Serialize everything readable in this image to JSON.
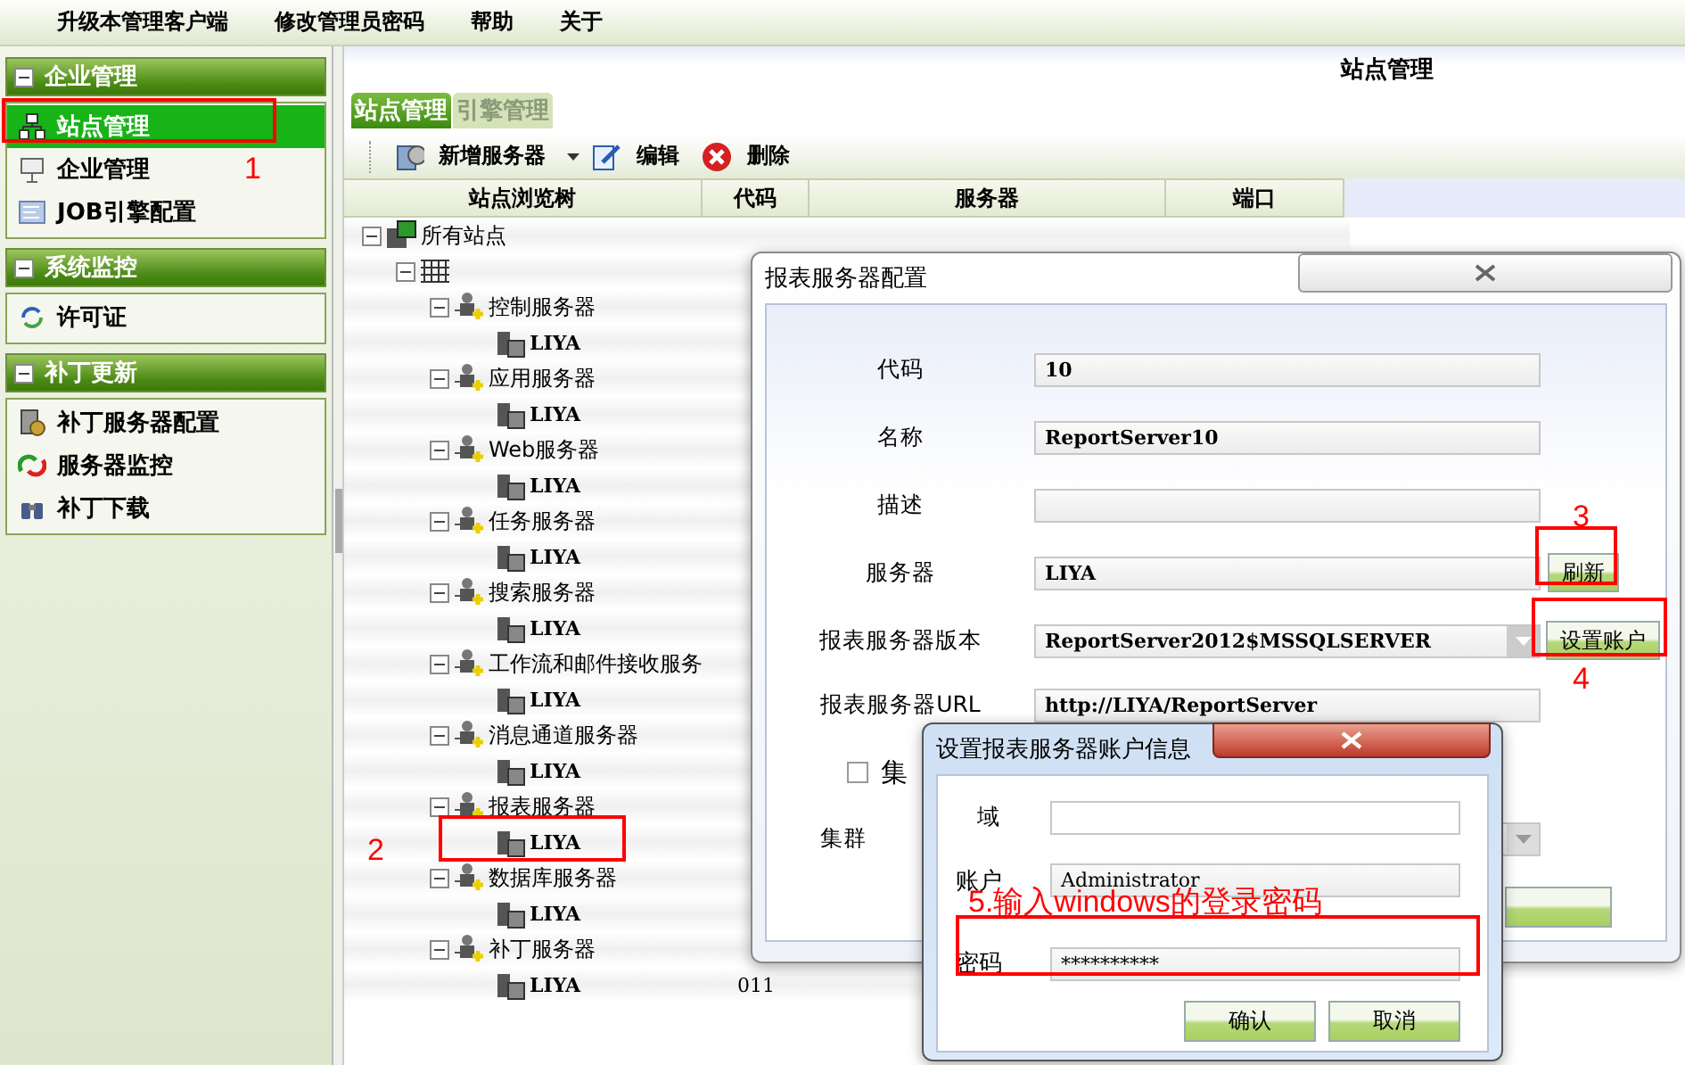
{
  "menu": [
    "升级本管理客户端",
    "修改管理员密码",
    "帮助",
    "关于"
  ],
  "sidebar": {
    "sections": [
      {
        "title": "企业管理",
        "expanded": true,
        "items": [
          {
            "label": "站点管理",
            "selected": true
          },
          {
            "label": "企业管理",
            "selected": false
          },
          {
            "label": "JOB引擎配置",
            "selected": false
          }
        ]
      },
      {
        "title": "系统监控",
        "expanded": true,
        "items": [
          {
            "label": "许可证",
            "selected": false
          }
        ]
      },
      {
        "title": "补丁更新",
        "expanded": true,
        "items": [
          {
            "label": "补丁服务器配置",
            "selected": false
          },
          {
            "label": "服务器监控",
            "selected": false
          },
          {
            "label": "补丁下载",
            "selected": false
          }
        ]
      }
    ]
  },
  "main": {
    "title": "站点管理",
    "tabs": [
      {
        "label": "站点管理",
        "selected": true
      },
      {
        "label": "引擎管理",
        "selected": false
      }
    ],
    "toolbar": [
      {
        "kind": "dropdown",
        "label": "新增服务器"
      },
      {
        "kind": "edit",
        "label": "编辑"
      },
      {
        "kind": "delete",
        "label": "删除"
      }
    ],
    "columns": [
      "站点浏览树",
      "代码",
      "服务器",
      "端口"
    ],
    "tree": {
      "label": "所有站点",
      "expanded": true,
      "children": [
        {
          "expanded": true,
          "children": [
            {
              "label": "控制服务器",
              "expanded": true,
              "children": [
                {
                  "label": "LIYA"
                }
              ]
            },
            {
              "label": "应用服务器",
              "expanded": true,
              "children": [
                {
                  "label": "LIYA"
                }
              ]
            },
            {
              "label": "Web服务器",
              "expanded": true,
              "children": [
                {
                  "label": "LIYA"
                }
              ]
            },
            {
              "label": "任务服务器",
              "expanded": true,
              "children": [
                {
                  "label": "LIYA"
                }
              ]
            },
            {
              "label": "搜索服务器",
              "expanded": true,
              "children": [
                {
                  "label": "LIYA"
                }
              ]
            },
            {
              "label": "工作流和邮件接收服务",
              "expanded": true,
              "children": [
                {
                  "label": "LIYA"
                }
              ]
            },
            {
              "label": "消息通道服务器",
              "expanded": true,
              "children": [
                {
                  "label": "LIYA"
                }
              ]
            },
            {
              "label": "报表服务器",
              "expanded": true,
              "children": [
                {
                  "label": "LIYA"
                }
              ]
            },
            {
              "label": "数据库服务器",
              "expanded": true,
              "children": [
                {
                  "label": "LIYA"
                }
              ]
            },
            {
              "label": "补丁服务器",
              "expanded": true,
              "children": [
                {
                  "label": "LIYA",
                  "code": "011"
                }
              ]
            }
          ]
        }
      ]
    }
  },
  "config_dialog": {
    "title": "报表服务器配置",
    "fields": [
      {
        "kind": "text",
        "label": "代码",
        "value": "10"
      },
      {
        "kind": "text",
        "label": "名称",
        "value": "ReportServer10"
      },
      {
        "kind": "text",
        "label": "描述"
      },
      {
        "kind": "text",
        "label": "服务器",
        "value": "LIYA",
        "button": "刷新"
      },
      {
        "kind": "select",
        "label": "报表服务器版本",
        "value": "ReportServer2012$MSSQLSERVER",
        "button": "设置账户"
      },
      {
        "kind": "text",
        "label": "报表服务器URL",
        "value": "http://LIYA/ReportServer"
      }
    ],
    "cluster": {
      "label": "集",
      "checked": false
    },
    "cluster_select": {
      "label": "集群"
    }
  },
  "account_dialog": {
    "title": "设置报表服务器账户信息",
    "fields": [
      {
        "label": "域"
      },
      {
        "label": "账户",
        "value": "Administrator"
      },
      {
        "label": "密码",
        "value": "**********"
      }
    ],
    "buttons": [
      "确认",
      "取消"
    ]
  },
  "annotations": [
    {
      "label": "1"
    },
    {
      "label": "2"
    },
    {
      "label": "3"
    },
    {
      "label": "4"
    },
    {
      "label": "5.输入windows的登录密码"
    }
  ]
}
